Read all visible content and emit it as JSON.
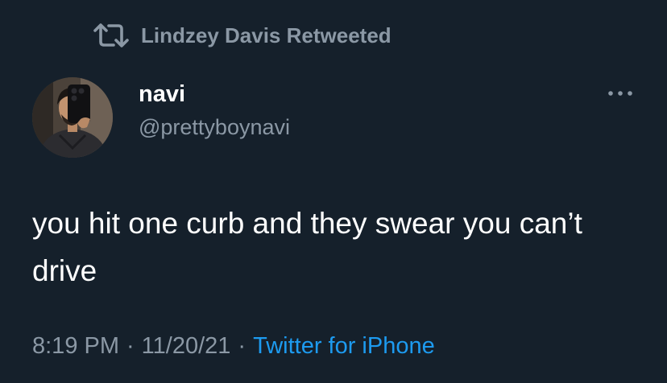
{
  "retweet": {
    "icon": "retweet-icon",
    "label": "Lindzey Davis Retweeted"
  },
  "author": {
    "name": "navi",
    "handle": "@prettyboynavi",
    "avatar": "avatar-photo"
  },
  "more_menu": {
    "icon": "more-horizontal-icon"
  },
  "tweet": {
    "text": "you hit one curb and they swear you can’t drive"
  },
  "meta": {
    "time": "8:19 PM",
    "separator": "·",
    "date": "11/20/21",
    "source": "Twitter for iPhone"
  },
  "colors": {
    "background": "#15202b",
    "primary_text": "#ffffff",
    "secondary_text": "#8b98a5",
    "accent": "#1d9bf0"
  }
}
